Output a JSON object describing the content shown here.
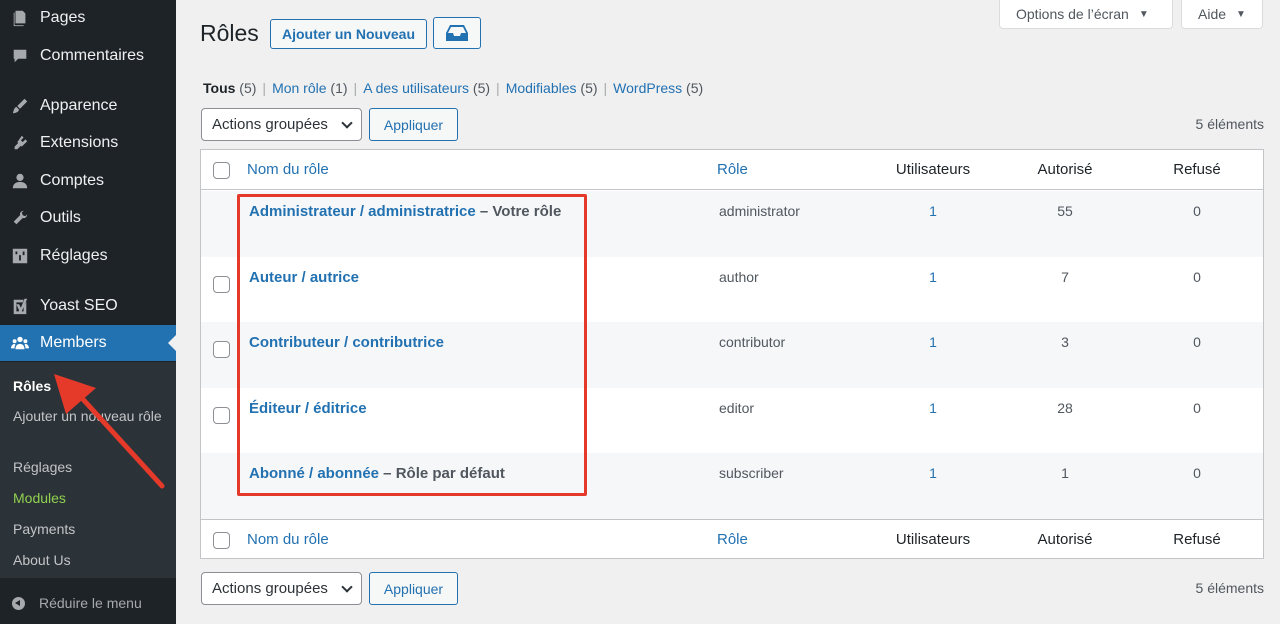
{
  "sidebar": {
    "items": [
      {
        "label": "Pages",
        "icon": "pages-icon"
      },
      {
        "label": "Commentaires",
        "icon": "comments-icon"
      },
      {
        "label": "Apparence",
        "icon": "appearance-icon"
      },
      {
        "label": "Extensions",
        "icon": "plugins-icon"
      },
      {
        "label": "Comptes",
        "icon": "users-icon"
      },
      {
        "label": "Outils",
        "icon": "tools-icon"
      },
      {
        "label": "Réglages",
        "icon": "settings-icon"
      },
      {
        "label": "Yoast SEO",
        "icon": "yoast-icon"
      },
      {
        "label": "Members",
        "icon": "members-icon"
      }
    ],
    "submenu": [
      {
        "label": "Rôles"
      },
      {
        "label": "Ajouter un nouveau rôle"
      },
      {
        "label": "Réglages"
      },
      {
        "label": "Modules"
      },
      {
        "label": "Payments"
      },
      {
        "label": "About Us"
      }
    ],
    "collapse_label": "Réduire le menu"
  },
  "topbar": {
    "screen_options": "Options de l’écran",
    "help": "Aide"
  },
  "header": {
    "title": "Rôles",
    "add_new": "Ajouter un Nouveau"
  },
  "filters": [
    {
      "label": "Tous",
      "count": "(5)"
    },
    {
      "label": "Mon rôle",
      "count": "(1)"
    },
    {
      "label": "A des utilisateurs",
      "count": "(5)"
    },
    {
      "label": "Modifiables",
      "count": "(5)"
    },
    {
      "label": "WordPress",
      "count": "(5)"
    }
  ],
  "bulk": {
    "select_label": "Actions groupées",
    "apply_label": "Appliquer",
    "items_count": "5 éléments"
  },
  "table": {
    "columns": [
      "Nom du rôle",
      "Rôle",
      "Utilisateurs",
      "Autorisé",
      "Refusé"
    ],
    "rows": [
      {
        "name": "Administrateur / administratrice",
        "note": " – Votre rôle",
        "slug": "administrator",
        "users": "1",
        "granted": "55",
        "denied": "0",
        "checkbox": false
      },
      {
        "name": "Auteur / autrice",
        "note": "",
        "slug": "author",
        "users": "1",
        "granted": "7",
        "denied": "0",
        "checkbox": true
      },
      {
        "name": "Contributeur / contributrice",
        "note": "",
        "slug": "contributor",
        "users": "1",
        "granted": "3",
        "denied": "0",
        "checkbox": true
      },
      {
        "name": "Éditeur / éditrice",
        "note": "",
        "slug": "editor",
        "users": "1",
        "granted": "28",
        "denied": "0",
        "checkbox": true
      },
      {
        "name": "Abonné / abonnée",
        "note": " – Rôle par défaut",
        "slug": "subscriber",
        "users": "1",
        "granted": "1",
        "denied": "0",
        "checkbox": false
      }
    ]
  },
  "annotation_color": "#e5392a",
  "accent_color": "#2271b1"
}
